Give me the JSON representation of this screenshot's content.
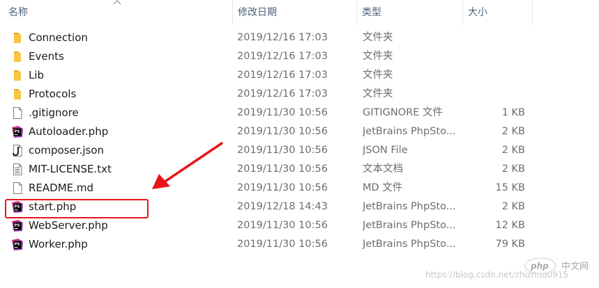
{
  "columns": {
    "name": "名称",
    "date": "修改日期",
    "type": "类型",
    "size": "大小"
  },
  "files": [
    {
      "name": "Connection",
      "date": "2019/12/16 17:03",
      "type": "文件夹",
      "size": "",
      "icon": "folder-icon"
    },
    {
      "name": "Events",
      "date": "2019/12/16 17:03",
      "type": "文件夹",
      "size": "",
      "icon": "folder-icon"
    },
    {
      "name": "Lib",
      "date": "2019/12/16 17:03",
      "type": "文件夹",
      "size": "",
      "icon": "folder-icon"
    },
    {
      "name": "Protocols",
      "date": "2019/12/16 17:03",
      "type": "文件夹",
      "size": "",
      "icon": "folder-icon"
    },
    {
      "name": ".gitignore",
      "date": "2019/11/30 10:56",
      "type": "GITIGNORE 文件",
      "size": "1 KB",
      "icon": "blank-file-icon"
    },
    {
      "name": "Autoloader.php",
      "date": "2019/11/30 10:56",
      "type": "JetBrains PhpSto...",
      "size": "2 KB",
      "icon": "phpstorm-file-icon"
    },
    {
      "name": "composer.json",
      "date": "2019/11/30 10:56",
      "type": "JSON File",
      "size": "2 KB",
      "icon": "json-file-icon"
    },
    {
      "name": "MIT-LICENSE.txt",
      "date": "2019/11/30 10:56",
      "type": "文本文档",
      "size": "2 KB",
      "icon": "text-file-icon"
    },
    {
      "name": "README.md",
      "date": "2019/11/30 10:56",
      "type": "MD 文件",
      "size": "15 KB",
      "icon": "blank-file-icon"
    },
    {
      "name": "start.php",
      "date": "2019/12/18 14:43",
      "type": "JetBrains PhpSto...",
      "size": "2 KB",
      "icon": "phpstorm-file-icon"
    },
    {
      "name": "WebServer.php",
      "date": "2019/11/30 10:56",
      "type": "JetBrains PhpSto...",
      "size": "12 KB",
      "icon": "phpstorm-file-icon"
    },
    {
      "name": "Worker.php",
      "date": "2019/11/30 10:56",
      "type": "JetBrains PhpSto...",
      "size": "79 KB",
      "icon": "phpstorm-file-icon"
    }
  ],
  "watermark": {
    "url": "https://blog.csdn.net/zhizhuo0915",
    "logo": "php",
    "site": "中文网"
  },
  "colors": {
    "folder": "#f8c640",
    "highlight": "#e8141a",
    "phpstorm_pink": "#e6267b",
    "phpstorm_purple": "#7b4ad4"
  }
}
